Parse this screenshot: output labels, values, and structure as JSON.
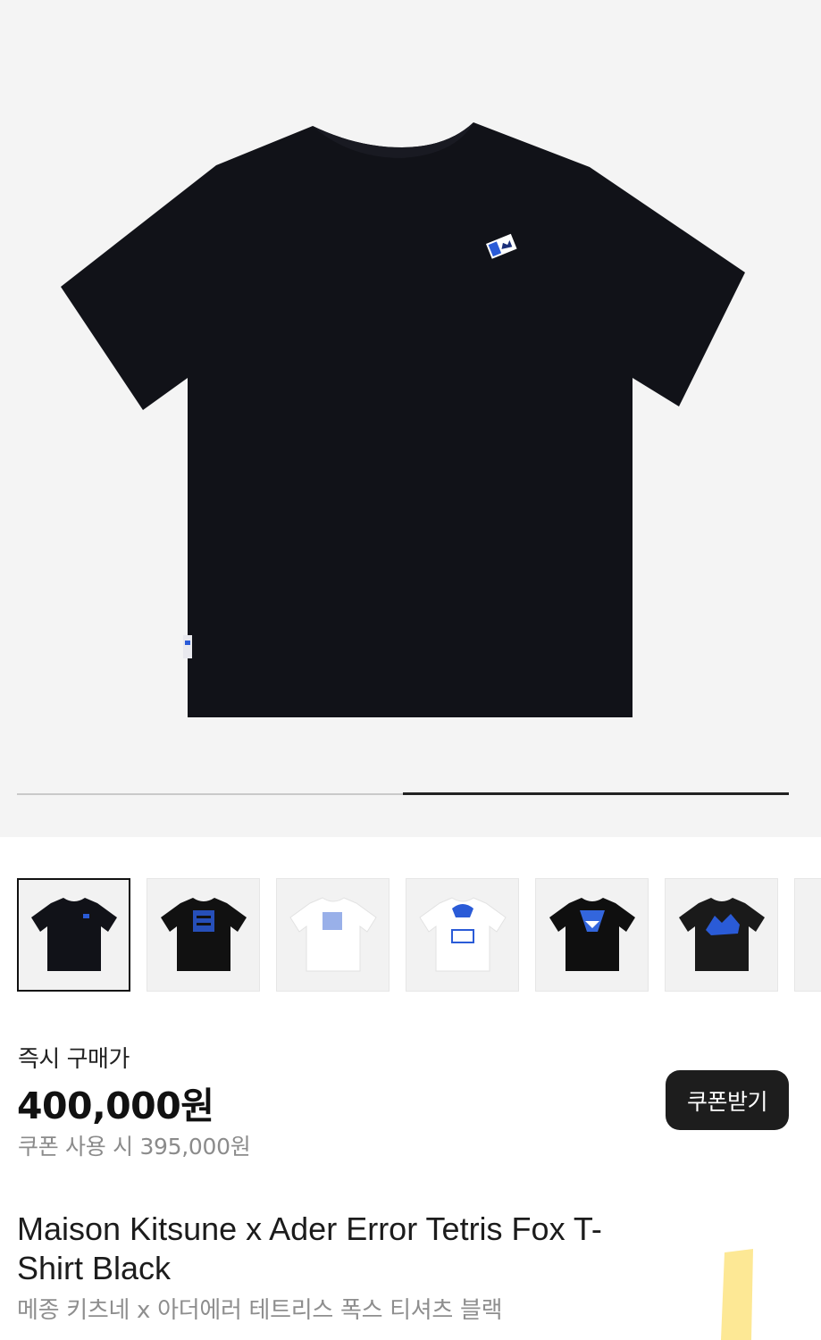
{
  "gallery": {
    "thumbnails": [
      {
        "variant": "black-small-logo",
        "color": "#111111"
      },
      {
        "variant": "black-blue-print",
        "color": "#111111"
      },
      {
        "variant": "white-blue-print",
        "color": "#ffffff"
      },
      {
        "variant": "white-graphic-print",
        "color": "#ffffff"
      },
      {
        "variant": "black-shark-print",
        "color": "#111111"
      },
      {
        "variant": "black-blue-fox",
        "color": "#1a1a1a"
      }
    ],
    "active_index": 0
  },
  "pricing": {
    "label": "즉시 구매가",
    "price": "400,000원",
    "coupon_price": "쿠폰 사용 시 395,000원",
    "coupon_button": "쿠폰받기"
  },
  "product": {
    "title": "Maison Kitsune x Ader Error Tetris Fox T-Shirt Black",
    "subtitle": "메종 키츠네 x 아더에러 테트리스 폭스 티셔츠 블랙"
  },
  "colors": {
    "shirt": "#111218",
    "accent_blue": "#2a5bd7",
    "highlight": "#fde68a"
  }
}
